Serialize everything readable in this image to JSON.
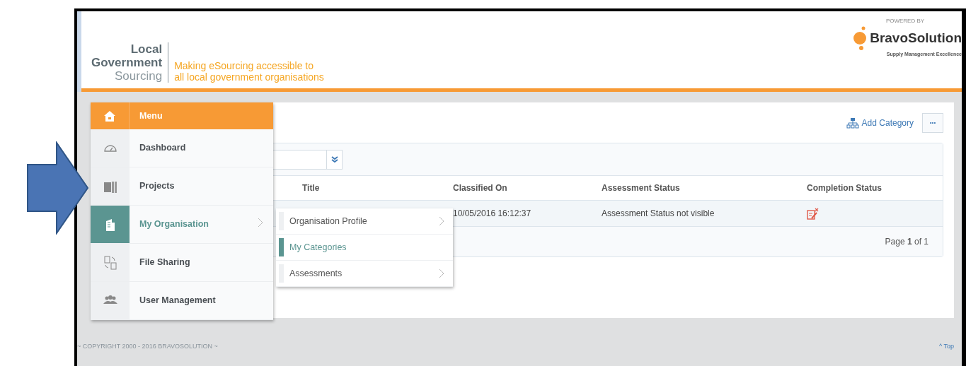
{
  "header": {
    "logo_lines": [
      "Local",
      "Government",
      "Sourcing"
    ],
    "tagline_lines": [
      "Making eSourcing accessible to",
      "all local government organisations"
    ],
    "powered_by": "POWERED BY",
    "brand": "BravoSolution",
    "brand_tagline": "Supply Management Excellence"
  },
  "menu": {
    "title": "Menu",
    "items": [
      {
        "label": "Dashboard",
        "kind": "gauge",
        "selected": false,
        "has_submenu": false
      },
      {
        "label": "Projects",
        "kind": "projects",
        "selected": false,
        "has_submenu": false
      },
      {
        "label": "My Organisation",
        "kind": "building",
        "selected": true,
        "has_submenu": true
      },
      {
        "label": "File Sharing",
        "kind": "files",
        "selected": false,
        "has_submenu": false
      },
      {
        "label": "User Management",
        "kind": "users",
        "selected": false,
        "has_submenu": false
      }
    ]
  },
  "submenu": {
    "items": [
      {
        "label": "Organisation Profile",
        "selected": false,
        "has_submenu": true
      },
      {
        "label": "My Categories",
        "selected": true,
        "has_submenu": false
      },
      {
        "label": "Assessments",
        "selected": false,
        "has_submenu": true
      }
    ]
  },
  "toolbar": {
    "add_button": "Add Category",
    "more_button": "•••"
  },
  "table": {
    "columns": [
      "Title",
      "Classified On",
      "Assessment Status",
      "Completion Status"
    ],
    "rows": [
      {
        "classified_on": "10/05/2016 16:12:37",
        "assessment_status": "Assessment Status not visible",
        "completed": false
      }
    ]
  },
  "pager": "Page **1** of 1",
  "footer": {
    "copyright": "~ COPYRIGHT 2000 - 2016 BRAVOSOLUTION ~",
    "top_link": "^ Top"
  }
}
